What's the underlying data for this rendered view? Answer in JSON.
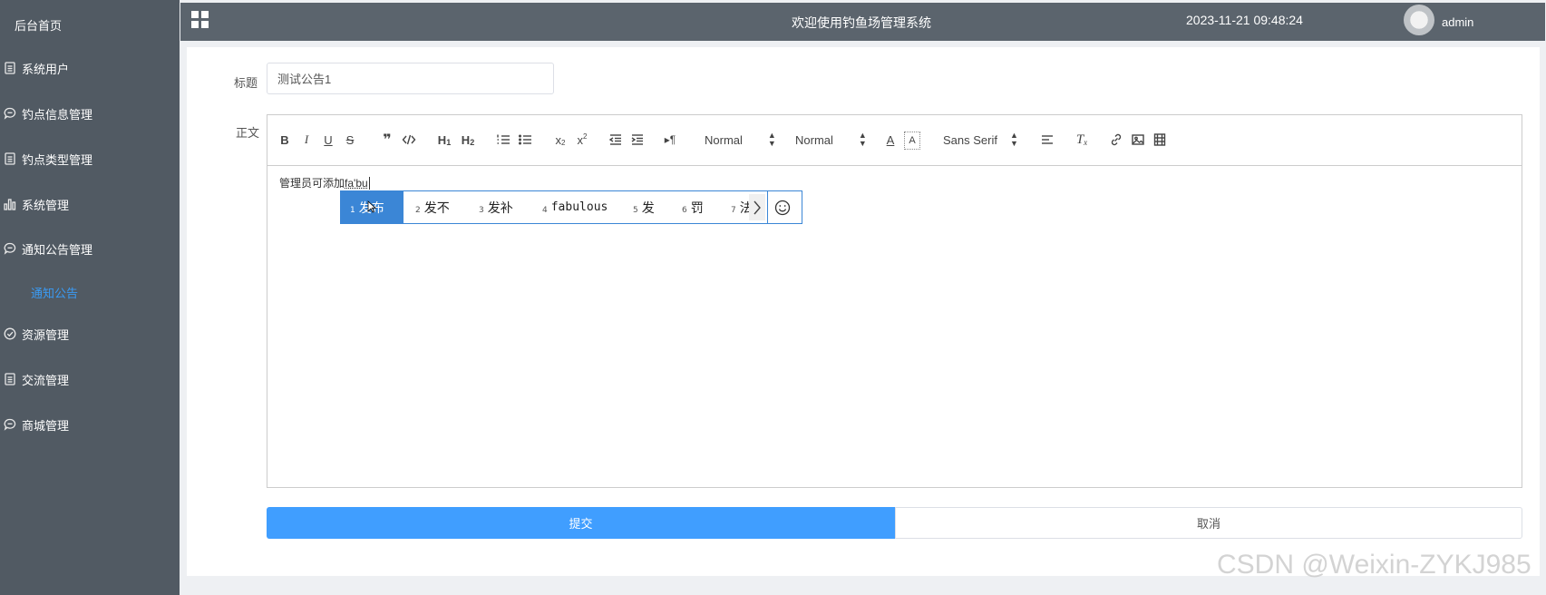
{
  "sidebar": {
    "home_label": "后台首页",
    "items": [
      {
        "label": "系统用户",
        "icon": "document-icon"
      },
      {
        "label": "钓点信息管理",
        "icon": "chat-icon"
      },
      {
        "label": "钓点类型管理",
        "icon": "document-icon"
      },
      {
        "label": "系统管理",
        "icon": "bar-chart-icon"
      },
      {
        "label": "通知公告管理",
        "icon": "chat-icon"
      },
      {
        "label": "资源管理",
        "icon": "check-circle-icon"
      },
      {
        "label": "交流管理",
        "icon": "document-icon"
      },
      {
        "label": "商城管理",
        "icon": "chat-icon"
      }
    ],
    "active_sub_label": "通知公告"
  },
  "header": {
    "title": "欢迎使用钓鱼场管理系统",
    "datetime": "2023-11-21 09:48:24",
    "username": "admin"
  },
  "form": {
    "title_label": "标题",
    "title_value": "测试公告1",
    "body_label": "正文",
    "toolbar": {
      "header_picker": "Normal",
      "size_picker": "Normal",
      "font_picker": "Sans Serif"
    },
    "content_text": "管理员可添加",
    "composition_text": "fa'bu",
    "submit_label": "提交",
    "cancel_label": "取消"
  },
  "ime": {
    "candidates": [
      {
        "num": "1",
        "text": "发布"
      },
      {
        "num": "2",
        "text": "发不"
      },
      {
        "num": "3",
        "text": "发补"
      },
      {
        "num": "4",
        "text": "fabulous"
      },
      {
        "num": "5",
        "text": "发"
      },
      {
        "num": "6",
        "text": "罚"
      },
      {
        "num": "7",
        "text": "法"
      }
    ]
  },
  "watermark": "CSDN @Weixin-ZYKJ985",
  "colors": {
    "sidebar_bg": "#515a63",
    "topbar_bg": "#5b646d",
    "accent": "#409eff",
    "ime_selected": "#3b86d6"
  }
}
